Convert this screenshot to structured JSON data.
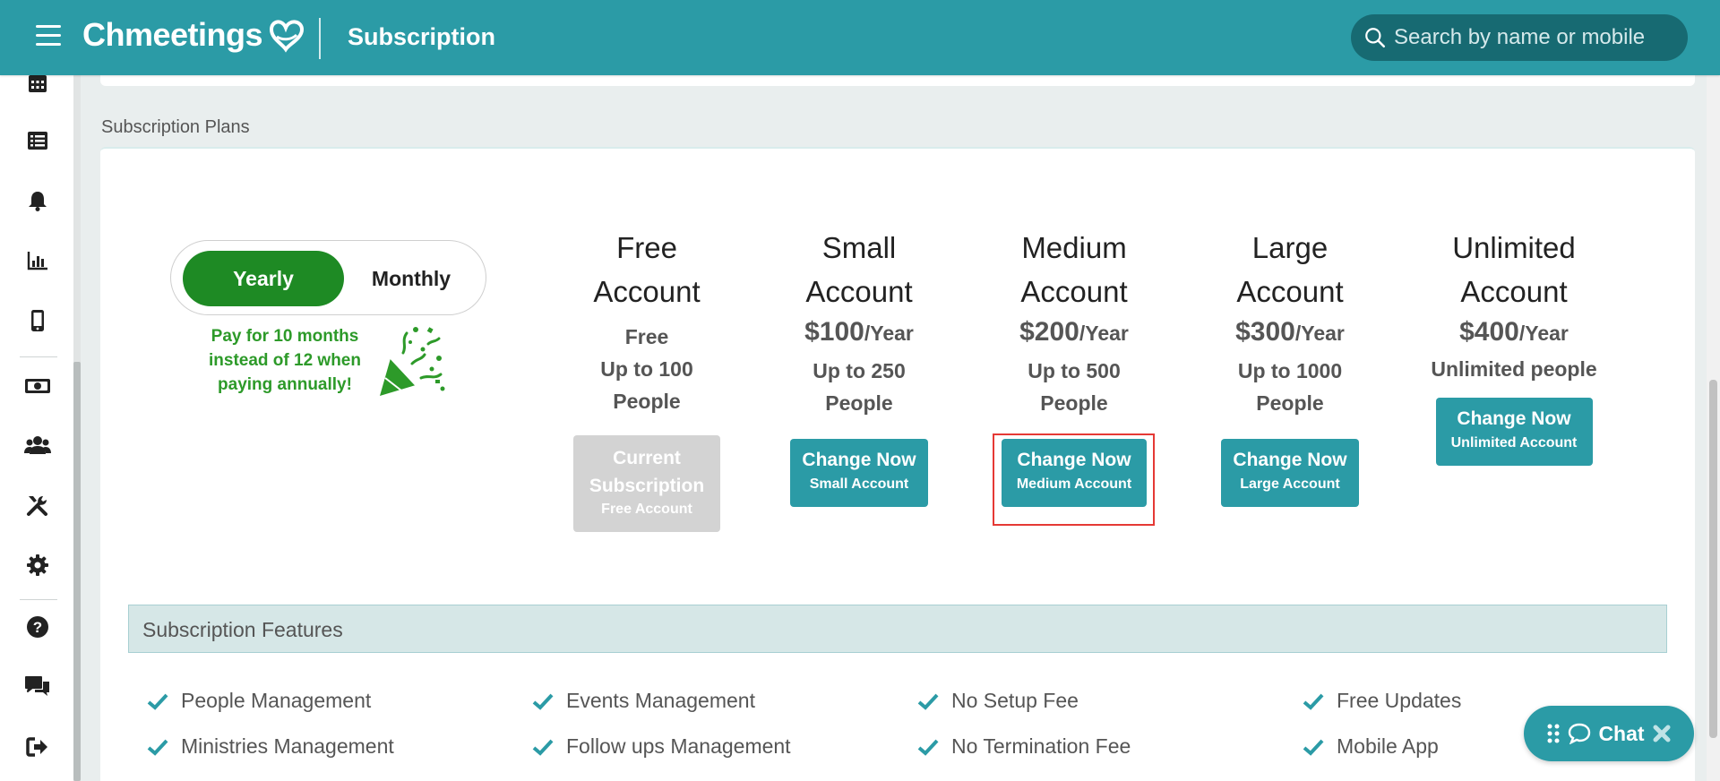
{
  "header": {
    "app_name": "Chmeetings",
    "page_title": "Subscription",
    "search_placeholder": "Search by name or mobile"
  },
  "sidebar": {
    "icons": [
      "calendar-icon",
      "list-icon",
      "bell-icon",
      "bar-chart-icon",
      "mobile-icon",
      "money-icon",
      "users-icon",
      "tools-icon",
      "gear-icon",
      "help-icon",
      "comments-icon",
      "sign-out-icon"
    ]
  },
  "plans_section": {
    "caption": "Subscription Plans",
    "toggle": {
      "yearly": "Yearly",
      "monthly": "Monthly",
      "selected": "Yearly"
    },
    "promo": "Pay for 10 months instead of 12 when paying annually!",
    "plans": [
      {
        "name_line1": "Free",
        "name_line2": "Account",
        "price_text": "Free",
        "people_line1": "Up to 100",
        "people_line2": "People",
        "button_line1": "Current",
        "button_line2": "Subscription",
        "button_line3": "Free Account"
      },
      {
        "name_line1": "Small",
        "name_line2": "Account",
        "price": "$100",
        "period": "/Year",
        "people_line1": "Up to 250",
        "people_line2": "People",
        "button_line1": "Change Now",
        "button_line2": "Small Account"
      },
      {
        "name_line1": "Medium",
        "name_line2": "Account",
        "price": "$200",
        "period": "/Year",
        "people_line1": "Up to 500",
        "people_line2": "People",
        "button_line1": "Change Now",
        "button_line2": "Medium Account"
      },
      {
        "name_line1": "Large",
        "name_line2": "Account",
        "price": "$300",
        "period": "/Year",
        "people_line1": "Up to 1000",
        "people_line2": "People",
        "button_line1": "Change Now",
        "button_line2": "Large Account"
      },
      {
        "name_line1": "Unlimited",
        "name_line2": "Account",
        "price": "$400",
        "period": "/Year",
        "people_line1": "Unlimited people",
        "button_line1": "Change Now",
        "button_line2": "Unlimited Account"
      }
    ]
  },
  "features_section": {
    "title": "Subscription Features",
    "items": [
      "People Management",
      "Events Management",
      "No Setup Fee",
      "Free Updates",
      "Ministries Management",
      "Follow ups Management",
      "No Termination Fee",
      "Mobile App"
    ]
  },
  "chat": {
    "label": "Chat"
  },
  "colors": {
    "primary": "#2b9ba6",
    "green": "#1e8a24",
    "highlight": "#e53935"
  }
}
